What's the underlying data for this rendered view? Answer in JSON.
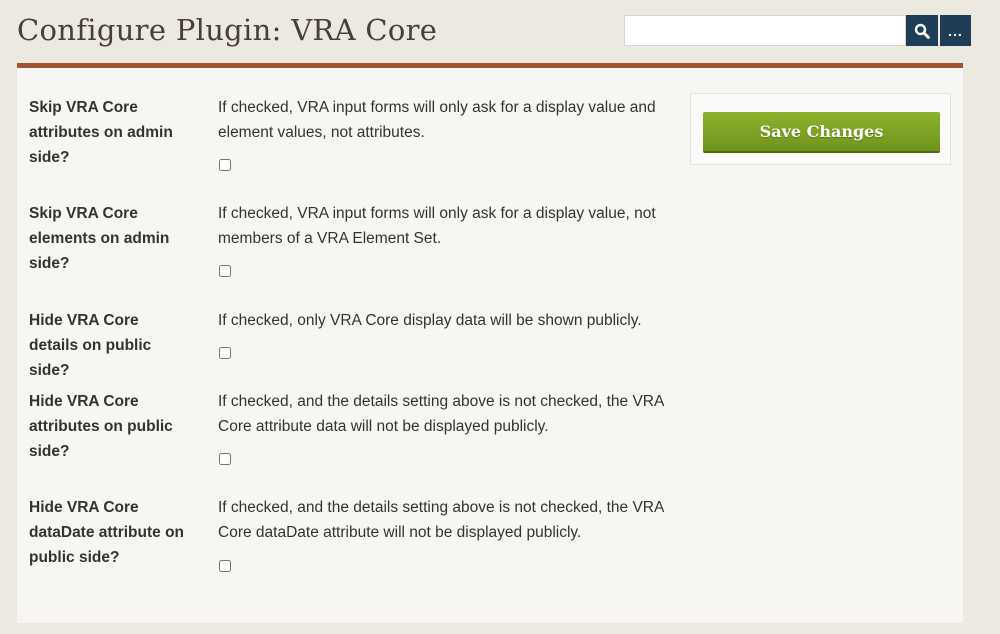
{
  "header": {
    "title": "Configure Plugin: VRA Core"
  },
  "search": {
    "value": "",
    "placeholder": "",
    "submit_icon": "search-icon",
    "advanced_label": "..."
  },
  "save": {
    "label": "Save Changes"
  },
  "fields": [
    {
      "label": "Skip VRA Core attributes on admin side?",
      "description": "If checked, VRA input forms will only ask for a display value and element values, not attributes.",
      "checked": false
    },
    {
      "label": "Skip VRA Core elements on admin side?",
      "description": "If checked, VRA input forms will only ask for a display value, not members of a VRA Element Set.",
      "checked": false
    },
    {
      "label": "Hide VRA Core details on public side?",
      "description": "If checked, only VRA Core display data will be shown publicly.",
      "checked": false
    },
    {
      "label": "Hide VRA Core attributes on public side?",
      "description": "If checked, and the details setting above is not checked, the VRA Core attribute data will not be displayed publicly.",
      "checked": false
    },
    {
      "label": "Hide VRA Core dataDate attribute on public side?",
      "description": "If checked, and the details setting above is not checked, the VRA Core dataDate attribute will not be displayed publicly.",
      "checked": false
    }
  ],
  "colors": {
    "accent_rule": "#a05232",
    "search_button": "#1f3d57",
    "save_button": "#7ba324"
  }
}
